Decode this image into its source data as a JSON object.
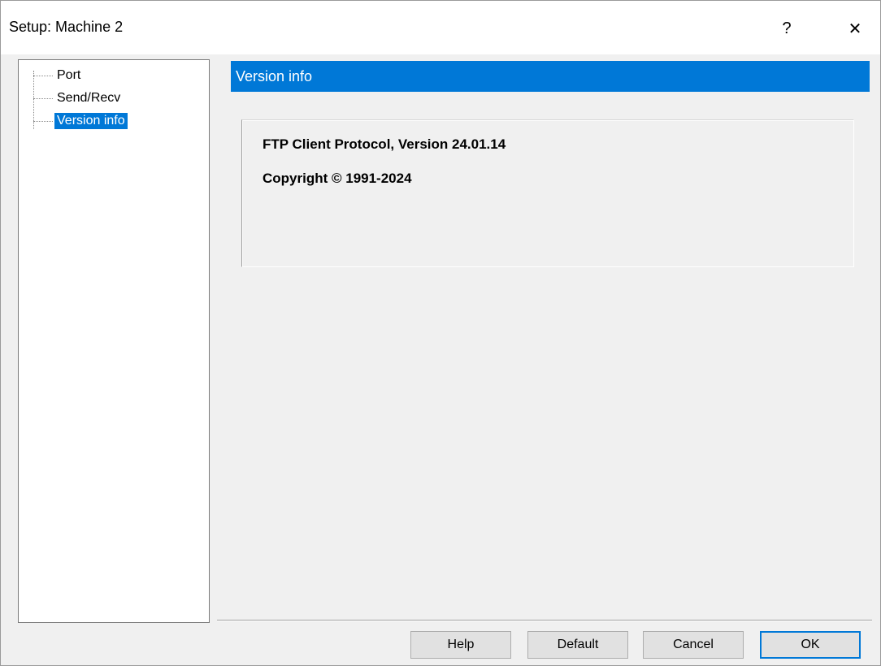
{
  "window": {
    "title": "Setup: Machine 2",
    "help_glyph": "?",
    "close_glyph": "✕"
  },
  "tree": {
    "items": [
      {
        "label": "Port",
        "selected": false
      },
      {
        "label": "Send/Recv",
        "selected": false
      },
      {
        "label": "Version info",
        "selected": true
      }
    ]
  },
  "panel": {
    "header": "Version info",
    "line1": "FTP Client Protocol, Version 24.01.14",
    "line2": "Copyright © 1991-2024"
  },
  "buttons": {
    "help": "Help",
    "default": "Default",
    "cancel": "Cancel",
    "ok": "OK"
  },
  "colors": {
    "accent": "#0078d7",
    "background": "#f0f0f0"
  }
}
